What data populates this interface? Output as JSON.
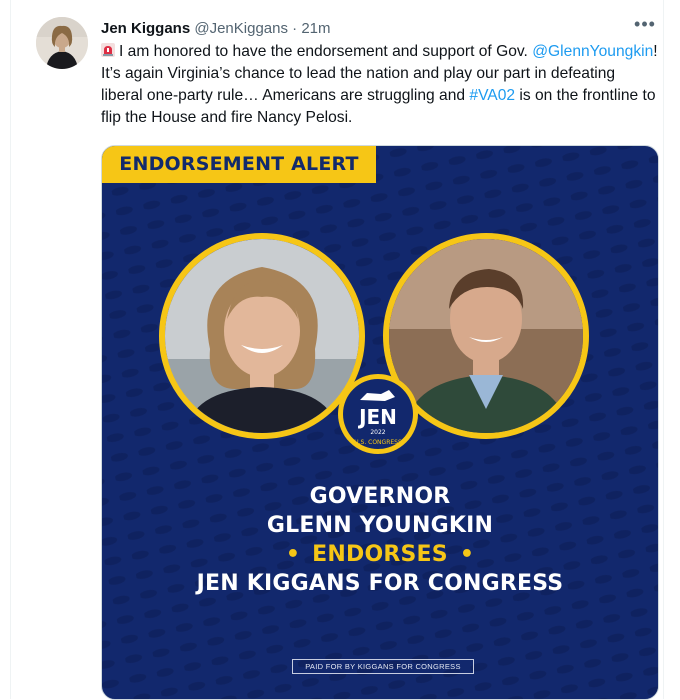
{
  "tweet": {
    "author_name": "Jen Kiggans",
    "author_handle": "@JenKiggans",
    "separator": "·",
    "time": "21m",
    "more_label": "•••",
    "text_parts": {
      "part1": "I am honored to have the endorsement and support of Gov.",
      "mention": "@GlennYoungkin",
      "part2": "! It’s again Virginia’s chance to lead the nation and play our part in defeating liberal one-party rule… Americans are struggling and",
      "hashtag": "#VA02",
      "part3": "is on the frontline to flip the House and fire Nancy Pelosi."
    },
    "icons": {
      "siren": "rotating-light-icon",
      "avatar": "avatar"
    }
  },
  "graphic": {
    "banner": "ENDORSEMENT ALERT",
    "line1": "GOVERNOR",
    "line2": "GLENN YOUNGKIN",
    "line3": "ENDORSES",
    "line4": "JEN KIGGANS FOR CONGRESS",
    "bullet": "•",
    "seal_name": "JEN",
    "seal_year": "2022",
    "seal_sub": "U.S. CONGRESS",
    "disclaimer": "PAID FOR BY KIGGANS FOR CONGRESS",
    "colors": {
      "navy": "#12286d",
      "gold": "#f6c616",
      "link": "#1d9bf0"
    }
  }
}
